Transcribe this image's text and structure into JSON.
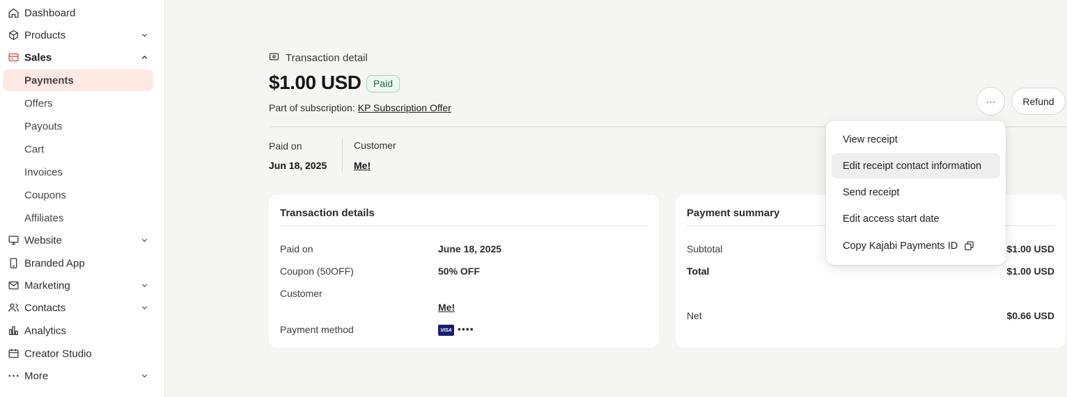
{
  "sidebar": {
    "items": [
      {
        "label": "Dashboard",
        "icon": "home-icon"
      },
      {
        "label": "Products",
        "icon": "box-icon"
      },
      {
        "label": "Sales",
        "icon": "credit-card-icon"
      },
      {
        "label": "Payments"
      },
      {
        "label": "Offers"
      },
      {
        "label": "Payouts"
      },
      {
        "label": "Cart"
      },
      {
        "label": "Invoices"
      },
      {
        "label": "Coupons"
      },
      {
        "label": "Affiliates"
      },
      {
        "label": "Website",
        "icon": "monitor-icon"
      },
      {
        "label": "Branded App",
        "icon": "phone-icon"
      },
      {
        "label": "Marketing",
        "icon": "mail-icon"
      },
      {
        "label": "Contacts",
        "icon": "users-icon"
      },
      {
        "label": "Analytics",
        "icon": "bar-chart-icon"
      },
      {
        "label": "Creator Studio",
        "icon": "calendar-icon"
      },
      {
        "label": "More",
        "icon": "ellipsis-icon"
      }
    ]
  },
  "header": {
    "breadcrumb": "Transaction detail",
    "amount": "$1.00 USD",
    "status": "Paid",
    "subscription_prefix": "Part of subscription:",
    "subscription_link": "KP Subscription Offer",
    "more_label": "···",
    "refund_label": "Refund"
  },
  "meta": {
    "paid_on_label": "Paid on",
    "paid_on_value": "Jun 18, 2025",
    "customer_label": "Customer",
    "customer_value": "Me!"
  },
  "transaction_details": {
    "title": "Transaction details",
    "rows": [
      {
        "label": "Paid on",
        "value": "June 18, 2025"
      },
      {
        "label": "Coupon (50OFF)",
        "value": "50% OFF"
      },
      {
        "label": "Customer",
        "value": "Me!"
      },
      {
        "label": "Payment method",
        "card_brand": "VISA",
        "masked": "••••"
      }
    ]
  },
  "payment_summary": {
    "title": "Payment summary",
    "rows": [
      {
        "label": "Subtotal",
        "value": "$1.00 USD"
      },
      {
        "label": "Total",
        "value": "$1.00 USD"
      },
      {
        "label": "Net",
        "value": "$0.66 USD"
      }
    ]
  },
  "menu": {
    "items": [
      "View receipt",
      "Edit receipt contact information",
      "Send receipt",
      "Edit access start date",
      "Copy Kajabi Payments ID"
    ]
  },
  "colors": {
    "accent": "#d9412e",
    "selected_bg": "#fde8e4",
    "paid_bg": "#ecf8f0",
    "paid_text": "#1e6b3d"
  }
}
